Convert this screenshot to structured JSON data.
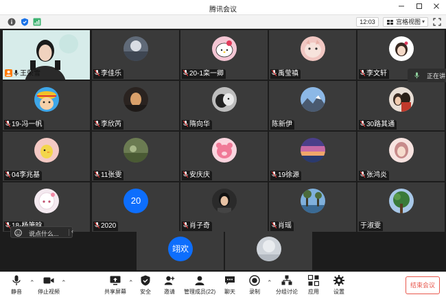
{
  "window": {
    "title": "腾讯会议"
  },
  "info": {
    "time": "12:03",
    "view_label": "宫格视图"
  },
  "side_panel": {
    "speaking_label": "正在讲"
  },
  "chat": {
    "placeholder": "说点什么..."
  },
  "participants": [
    {
      "name": "王荣雪",
      "host": true,
      "avatar": "host-video"
    },
    {
      "name": "李佳乐",
      "avatar": "moon-sky"
    },
    {
      "name": "20-1栾一卿",
      "avatar": "hello-kitty"
    },
    {
      "name": "禹莹禛",
      "avatar": "cat-pink"
    },
    {
      "name": "李文轩",
      "avatar": "girl-drawing"
    },
    {
      "name": "19-冯一帆",
      "avatar": "anime-pirate"
    },
    {
      "name": "李欣芮",
      "avatar": "dark-portrait"
    },
    {
      "name": "隋向华",
      "avatar": "dog-bw"
    },
    {
      "name": "陈新伊",
      "avatar": "mountain-sky"
    },
    {
      "name": "30路其通",
      "avatar": "couple-photo"
    },
    {
      "name": "04李兆基",
      "avatar": "yellow-bird"
    },
    {
      "name": "11张雯",
      "avatar": "field-green"
    },
    {
      "name": "安庆庆",
      "avatar": "strawberry-bear"
    },
    {
      "name": "19徐源",
      "avatar": "purple-sunset"
    },
    {
      "name": "张鸿炎",
      "avatar": "girl-pink-hair"
    },
    {
      "name": "18-杨箫晗",
      "avatar": "anime-girl-white"
    },
    {
      "name": "2020",
      "avatar": "number-20",
      "avatar_text": "20"
    },
    {
      "name": "肖子奇",
      "avatar": "woman-dark"
    },
    {
      "name": "肖瑶",
      "avatar": "lake-trees"
    },
    {
      "name": "于淑雯",
      "avatar": "tree-leaves"
    },
    {
      "name": "",
      "avatar": "number-name",
      "avatar_text": "翊欢"
    },
    {
      "name": "",
      "avatar": "sky-grey"
    }
  ],
  "toolbar": {
    "mute": "静音",
    "stop_video": "停止视频",
    "share_screen": "共享屏幕",
    "security": "安全",
    "invite": "邀请",
    "manage_members": "管理成员(22)",
    "chat": "聊天",
    "record": "录制",
    "breakout": "分组讨论",
    "apps": "应用",
    "settings": "设置",
    "end_meeting": "结束会议"
  },
  "colors": {
    "accent": "#0d6efd",
    "end": "#e8564b",
    "host_badge": "#ff7a00"
  }
}
